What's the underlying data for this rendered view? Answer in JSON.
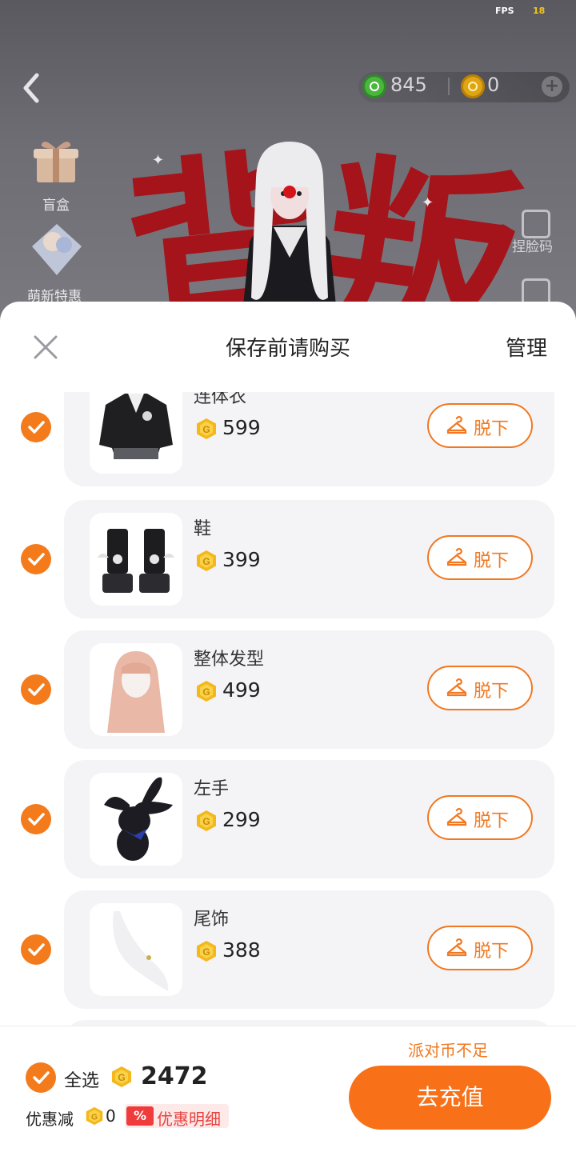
{
  "status": {
    "fps_label": "FPS",
    "fps_value": "18"
  },
  "top_bar": {
    "party_coins": "845",
    "gold_coins": "0",
    "colors": {
      "green_coin": "#4bb63e",
      "gold_coin": "#e0a514"
    }
  },
  "sidebar": {
    "blind_box_label": "盲盒",
    "newbie_label": "萌新特惠"
  },
  "right_tools": {
    "face_code_label": "捏脸码"
  },
  "backdrop_text": {
    "char1": "背",
    "char2": "叛"
  },
  "sheet": {
    "title": "保存前请购买",
    "manage_label": "管理",
    "takeoff_label": "脱下",
    "items": [
      {
        "name": "连体衣",
        "price": "599",
        "checked": true,
        "icon": "onesie-thumbnail"
      },
      {
        "name": "鞋",
        "price": "399",
        "checked": true,
        "icon": "shoes-thumbnail"
      },
      {
        "name": "整体发型",
        "price": "499",
        "checked": true,
        "icon": "hairstyle-thumbnail"
      },
      {
        "name": "左手",
        "price": "299",
        "checked": true,
        "icon": "bunny-plush-thumbnail"
      },
      {
        "name": "尾饰",
        "price": "388",
        "checked": true,
        "icon": "tail-thumbnail"
      }
    ]
  },
  "footer": {
    "select_all_label": "全选",
    "total": "2472",
    "discount_label": "优惠减",
    "discount_value": "0",
    "discount_badge": "%",
    "discount_detail_label": "优惠明细",
    "insufficient_label": "派对币不足",
    "recharge_label": "去充值",
    "colors": {
      "accent": "#f87118",
      "discount_red": "#e8413f"
    }
  }
}
